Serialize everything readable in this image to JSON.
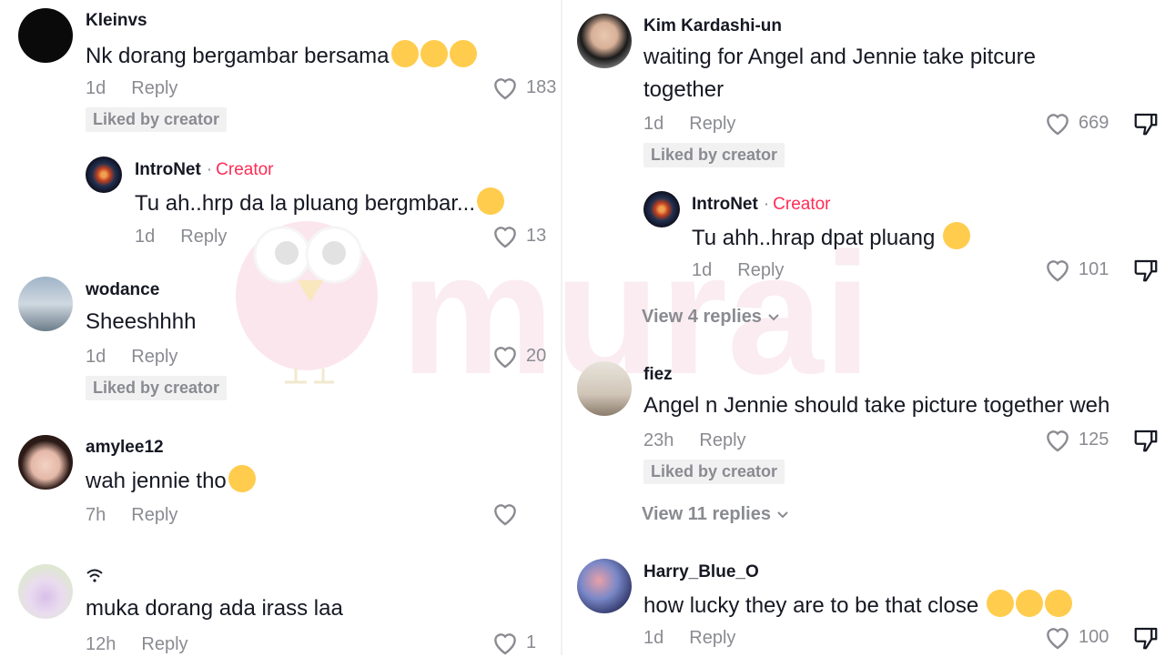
{
  "left_column": [
    {
      "username": "Kleinvs",
      "text": "Nk dorang bergambar bersama",
      "emojis": [
        "loudly-crying-face",
        "loudly-crying-face",
        "loudly-crying-face"
      ],
      "time": "1d",
      "reply": "Reply",
      "likes": "183",
      "liked_by_creator": "Liked by creator"
    },
    {
      "username": "IntroNet",
      "creator_label": "Creator",
      "text": "Tu ah..hrp da la pluang bergmbar...",
      "emojis": [
        "grinning-face"
      ],
      "time": "1d",
      "reply": "Reply",
      "likes": "13"
    },
    {
      "username": "wodance",
      "text": "Sheeshhhh",
      "time": "1d",
      "reply": "Reply",
      "likes": "20",
      "liked_by_creator": "Liked by creator"
    },
    {
      "username": "amylee12",
      "text": "wah jennie tho",
      "emojis": [
        "smiling-face-with-hearts"
      ],
      "time": "7h",
      "reply": "Reply",
      "likes": ""
    },
    {
      "username": "",
      "text": "muka dorang ada irass laa",
      "time": "12h",
      "reply": "Reply",
      "likes": "1"
    }
  ],
  "right_column": [
    {
      "username": "Kim Kardashi-un",
      "text_line1": "waiting for Angel and Jennie take pitcure",
      "text_line2": "together",
      "time": "1d",
      "reply": "Reply",
      "likes": "669",
      "liked_by_creator": "Liked by creator"
    },
    {
      "username": "IntroNet",
      "creator_label": "Creator",
      "text": "Tu ahh..hrap dpat pluang",
      "emojis": [
        "grinning-face"
      ],
      "time": "1d",
      "reply": "Reply",
      "likes": "101"
    },
    {
      "view_replies": "View 4 replies"
    },
    {
      "username": "fiez",
      "text": "Angel n Jennie should take picture together weh",
      "time": "23h",
      "reply": "Reply",
      "likes": "125",
      "liked_by_creator": "Liked by creator"
    },
    {
      "view_replies": "View 11 replies"
    },
    {
      "username": "Harry_Blue_O",
      "text": "how lucky they are to be that close",
      "emojis": [
        "loudly-crying-face",
        "loudly-crying-face",
        "loudly-crying-face"
      ],
      "time": "1d",
      "reply": "Reply",
      "likes": "100"
    }
  ],
  "colors": {
    "creator": "#fe2c55",
    "muted": "#8a8b91",
    "text": "#161823",
    "badge_bg": "#f1f1f2",
    "watermark": "#f3c9d4"
  }
}
